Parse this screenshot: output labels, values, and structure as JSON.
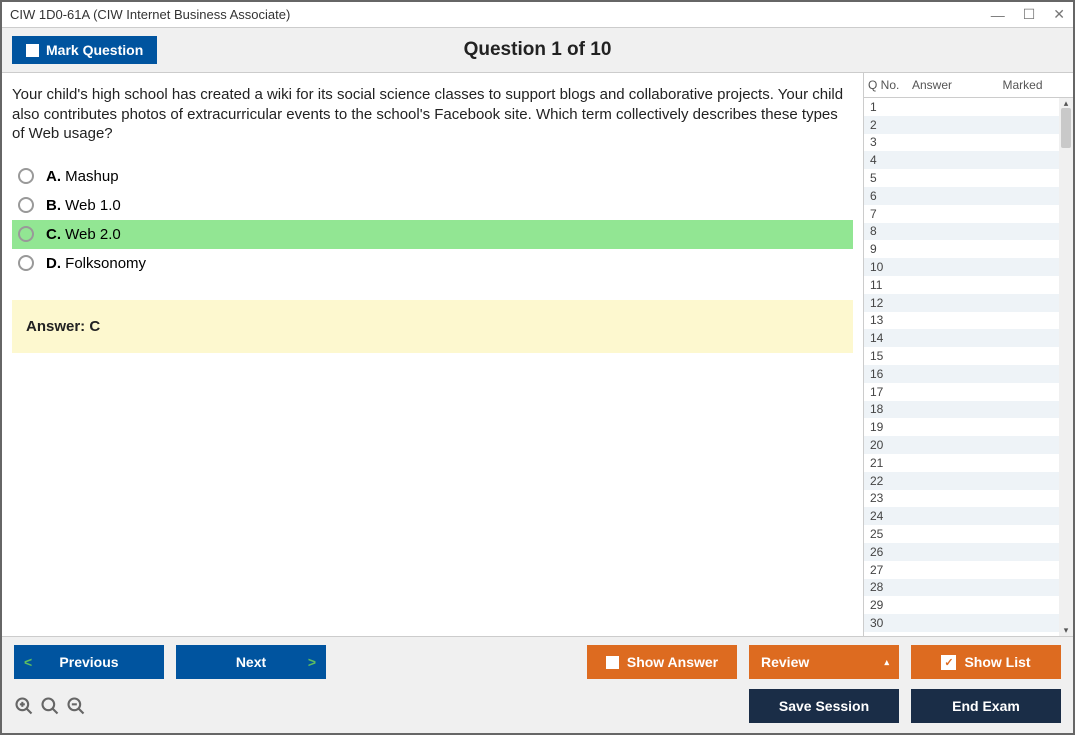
{
  "title": "CIW 1D0-61A (CIW Internet Business Associate)",
  "toolbar": {
    "mark_label": "Mark Question",
    "question_title": "Question 1 of 10"
  },
  "question": {
    "text": "Your child's high school has created a wiki for its social science classes to support blogs and collaborative projects. Your child also contributes photos of extracurricular events to the school's Facebook site. Which term collectively describes these types of Web usage?",
    "options": [
      {
        "letter": "A.",
        "text": "Mashup",
        "correct": false
      },
      {
        "letter": "B.",
        "text": "Web 1.0",
        "correct": false
      },
      {
        "letter": "C.",
        "text": "Web 2.0",
        "correct": true
      },
      {
        "letter": "D.",
        "text": "Folksonomy",
        "correct": false
      }
    ],
    "answer_label": "Answer: C"
  },
  "sidepanel": {
    "headers": {
      "qno": "Q No.",
      "answer": "Answer",
      "marked": "Marked"
    },
    "rows_count": 30,
    "selected": 1
  },
  "footer": {
    "previous": "Previous",
    "next": "Next",
    "show_answer": "Show Answer",
    "review": "Review",
    "show_list": "Show List",
    "save_session": "Save Session",
    "end_exam": "End Exam"
  }
}
